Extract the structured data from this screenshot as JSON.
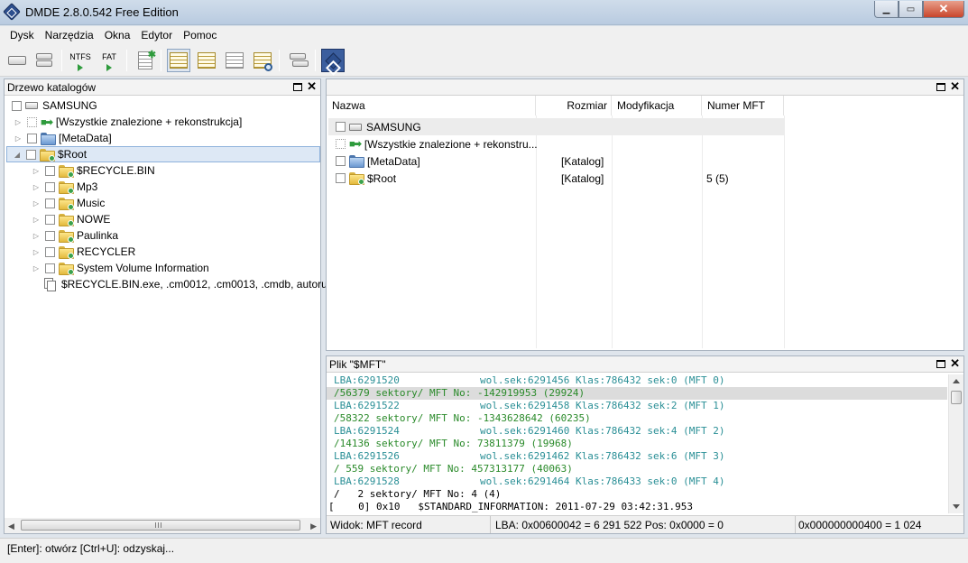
{
  "window": {
    "title": "DMDE 2.8.0.542 Free Edition"
  },
  "menu": [
    "Dysk",
    "Narzędzia",
    "Okna",
    "Edytor",
    "Pomoc"
  ],
  "toolbar": {
    "ntfs_label": "NTFS",
    "fat_label": "FAT"
  },
  "tree_panel": {
    "title": "Drzewo katalogów",
    "items": [
      {
        "label": "SAMSUNG"
      },
      {
        "label": "[Wszystkie znalezione + rekonstrukcja]"
      },
      {
        "label": "[MetaData]"
      },
      {
        "label": "$Root"
      },
      {
        "label": "$RECYCLE.BIN"
      },
      {
        "label": "Mp3"
      },
      {
        "label": "Music"
      },
      {
        "label": "NOWE"
      },
      {
        "label": "Paulinka"
      },
      {
        "label": "RECYCLER"
      },
      {
        "label": "System Volume Information"
      },
      {
        "label": "$RECYCLE.BIN.exe, .cm0012, .cm0013, .cmdb, autorun."
      }
    ]
  },
  "list_panel": {
    "columns": [
      "Nazwa",
      "Rozmiar",
      "Modyfikacja",
      "Numer MFT"
    ],
    "rows": [
      {
        "name": "SAMSUNG",
        "size": "",
        "modified": "",
        "mft": ""
      },
      {
        "name": "[Wszystkie znalezione + rekonstru...",
        "size": "",
        "modified": "",
        "mft": ""
      },
      {
        "name": "[MetaData]",
        "size": "[Katalog]",
        "modified": "",
        "mft": ""
      },
      {
        "name": "$Root",
        "size": "[Katalog]",
        "modified": "",
        "mft": "5 (5)"
      }
    ]
  },
  "mft_panel": {
    "title": "Plik \"$MFT\"",
    "lines": [
      {
        "left": "LBA:6291520",
        "right": "wol.sek:6291456 Klas:786432 sek:0 (MFT 0)"
      },
      {
        "full": "/56379 sektory/ MFT No: -142919953 (29924)"
      },
      {
        "left": "LBA:6291522",
        "right": "wol.sek:6291458 Klas:786432 sek:2 (MFT 1)"
      },
      {
        "full": "/58322 sektory/ MFT No: -1343628642 (60235)"
      },
      {
        "left": "LBA:6291524",
        "right": "wol.sek:6291460 Klas:786432 sek:4 (MFT 2)"
      },
      {
        "full": "/14136 sektory/ MFT No: 73811379 (19968)"
      },
      {
        "left": "LBA:6291526",
        "right": "wol.sek:6291462 Klas:786432 sek:6 (MFT 3)"
      },
      {
        "full": "/ 559 sektory/ MFT No: 457313177 (40063)"
      },
      {
        "left": "LBA:6291528",
        "right": "wol.sek:6291464 Klas:786433 sek:0 (MFT 4)"
      },
      {
        "full": "/   2 sektory/ MFT No: 4 (4)"
      },
      {
        "full": "[    0] 0x10   $STANDARD_INFORMATION: 2011-07-29 03:42:31.953"
      }
    ],
    "footer_view": "Widok: MFT record",
    "footer_lba": "LBA: 0x00600042 = 6 291 522  Pos: 0x0000 = 0",
    "footer_offset": "0x000000000400 = 1 024"
  },
  "statusbar": {
    "text": "[Enter]: otwórz  [Ctrl+U]: odzyskaj..."
  },
  "colors": {
    "teal_text": "#2a8f96",
    "green_text": "#2a8a2a",
    "selection": "#dde8f5"
  }
}
